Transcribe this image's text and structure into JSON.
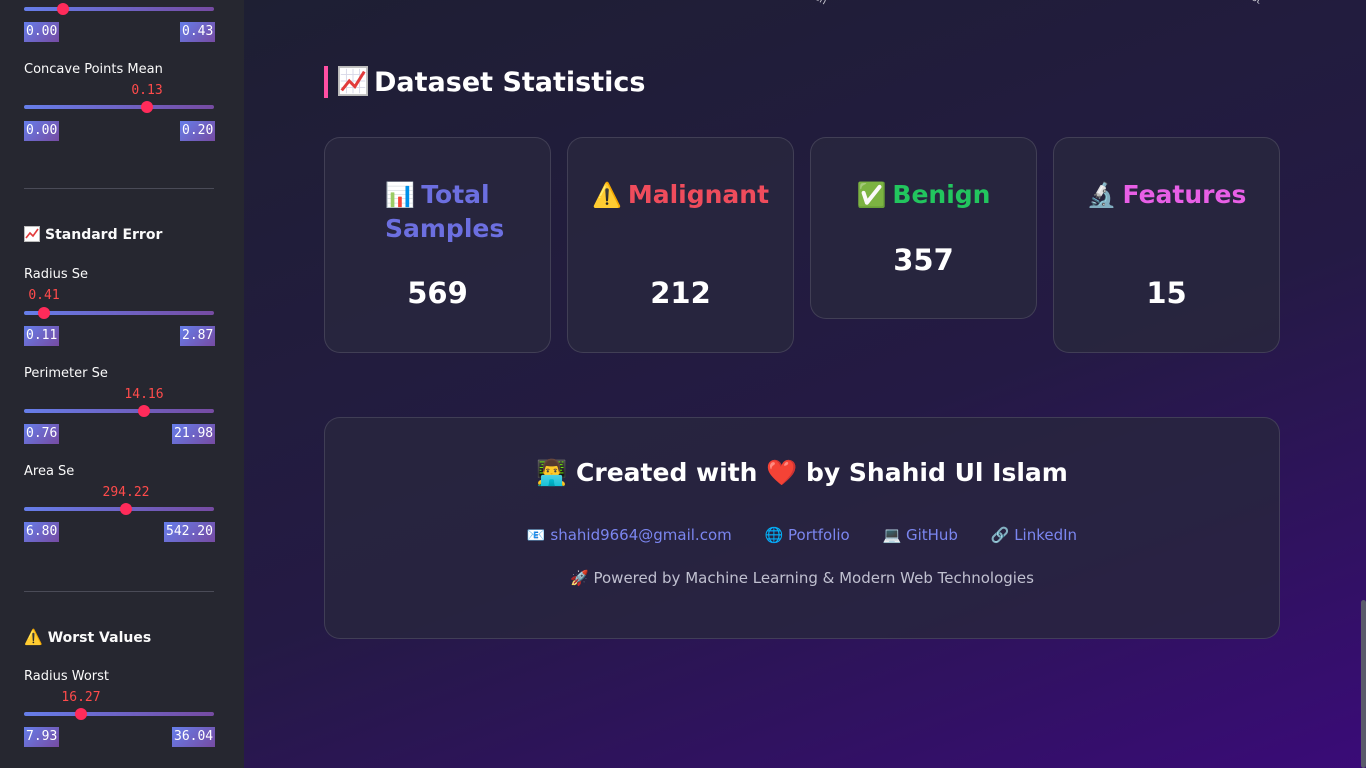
{
  "sidebar": {
    "top_slider": {
      "min": "0.00",
      "max": "0.43",
      "fraction": 0.2
    },
    "concave_points_mean": {
      "label": "Concave Points Mean",
      "value": "0.13",
      "min": "0.00",
      "max": "0.20",
      "fraction": 0.65
    },
    "standard_error": {
      "heading": "Standard Error",
      "radius_se": {
        "label": "Radius Se",
        "value": "0.41",
        "min": "0.11",
        "max": "2.87",
        "fraction": 0.11
      },
      "perimeter_se": {
        "label": "Perimeter Se",
        "value": "14.16",
        "min": "0.76",
        "max": "21.98",
        "fraction": 0.63
      },
      "area_se": {
        "label": "Area Se",
        "value": "294.22",
        "min": "6.80",
        "max": "542.20",
        "fraction": 0.54
      }
    },
    "worst_values": {
      "heading": "Worst Values",
      "radius_worst": {
        "label": "Radius Worst",
        "value": "16.27",
        "min": "7.93",
        "max": "36.04",
        "fraction": 0.3
      }
    }
  },
  "main": {
    "top_tick_labels": [
      "an",
      "st"
    ],
    "stats_title": "Dataset Statistics",
    "stats_icon": "chart-up-icon",
    "cards": [
      {
        "icon": "📊",
        "title": "Total Samples",
        "value": "569",
        "color": "#6c6fe0"
      },
      {
        "icon": "⚠️",
        "title": "Malignant",
        "value": "212",
        "color": "#ef4c5c"
      },
      {
        "icon": "✅",
        "title": "Benign",
        "value": "357",
        "color": "#22c55e"
      },
      {
        "icon": "🔬",
        "title": "Features",
        "value": "15",
        "color": "#e85fe6"
      }
    ],
    "footer": {
      "created_prefix": "Created with",
      "created_suffix": "by Shahid Ul Islam",
      "links": {
        "email": "shahid9664@gmail.com",
        "portfolio": "Portfolio",
        "github": "GitHub",
        "linkedin": "LinkedIn"
      },
      "powered": "Powered by Machine Learning & Modern Web Technologies"
    }
  },
  "colors": {
    "accent_pink": "#ff4fa3",
    "slider_thumb": "#ff2b5a",
    "link": "#7b86f0"
  }
}
